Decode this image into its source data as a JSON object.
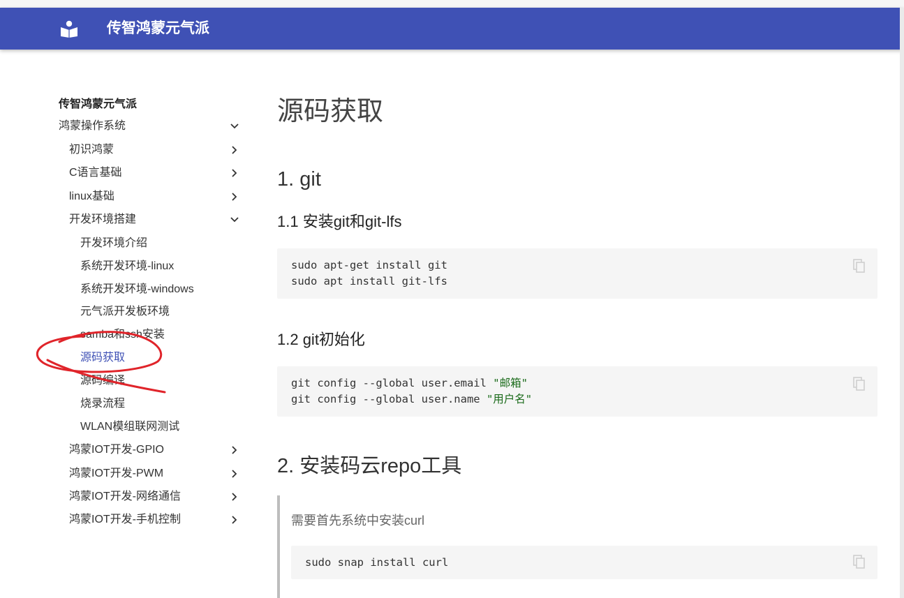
{
  "header": {
    "site_title": "传智鸿蒙元气派",
    "color": "#3f51b5"
  },
  "sidebar": {
    "title": "传智鸿蒙元气派",
    "items": [
      {
        "label": "鸿蒙操作系统",
        "chevron": "down"
      },
      {
        "label": "初识鸿蒙",
        "chevron": "right"
      },
      {
        "label": "C语言基础",
        "chevron": "right"
      },
      {
        "label": "linux基础",
        "chevron": "right"
      },
      {
        "label": "开发环境搭建",
        "chevron": "down"
      },
      {
        "label": "开发环境介绍"
      },
      {
        "label": "系统开发环境-linux"
      },
      {
        "label": "系统开发环境-windows"
      },
      {
        "label": "元气派开发板环境"
      },
      {
        "label": "samba和ssh安装"
      },
      {
        "label": "源码获取",
        "active": true
      },
      {
        "label": "源码编译"
      },
      {
        "label": "烧录流程"
      },
      {
        "label": "WLAN模组联网测试"
      },
      {
        "label": "鸿蒙IOT开发-GPIO",
        "chevron": "right"
      },
      {
        "label": "鸿蒙IOT开发-PWM",
        "chevron": "right"
      },
      {
        "label": "鸿蒙IOT开发-网络通信",
        "chevron": "right"
      },
      {
        "label": "鸿蒙IOT开发-手机控制",
        "chevron": "right"
      }
    ]
  },
  "content": {
    "page_title": "源码获取",
    "section1": {
      "heading": "1. git",
      "sub1": {
        "heading": "1.1 安装git和git-lfs",
        "code": [
          "sudo apt-get install git",
          "sudo apt install git-lfs"
        ]
      },
      "sub2": {
        "heading": "1.2 git初始化",
        "code": [
          {
            "cmd": "git config --global user.email ",
            "str": "\"邮箱\""
          },
          {
            "cmd": "git config --global user.name ",
            "str": "\"用户名\""
          }
        ]
      }
    },
    "section2": {
      "heading": "2. 安装码云repo工具",
      "note": "需要首先系统中安装curl",
      "code": [
        "sudo snap install curl"
      ]
    }
  },
  "icons": {
    "logo": "reader-book-icon",
    "copy": "copy-icon",
    "chevron_down": "chevron-down-icon",
    "chevron_right": "chevron-right-icon"
  },
  "annotation_color": "#e0242a"
}
